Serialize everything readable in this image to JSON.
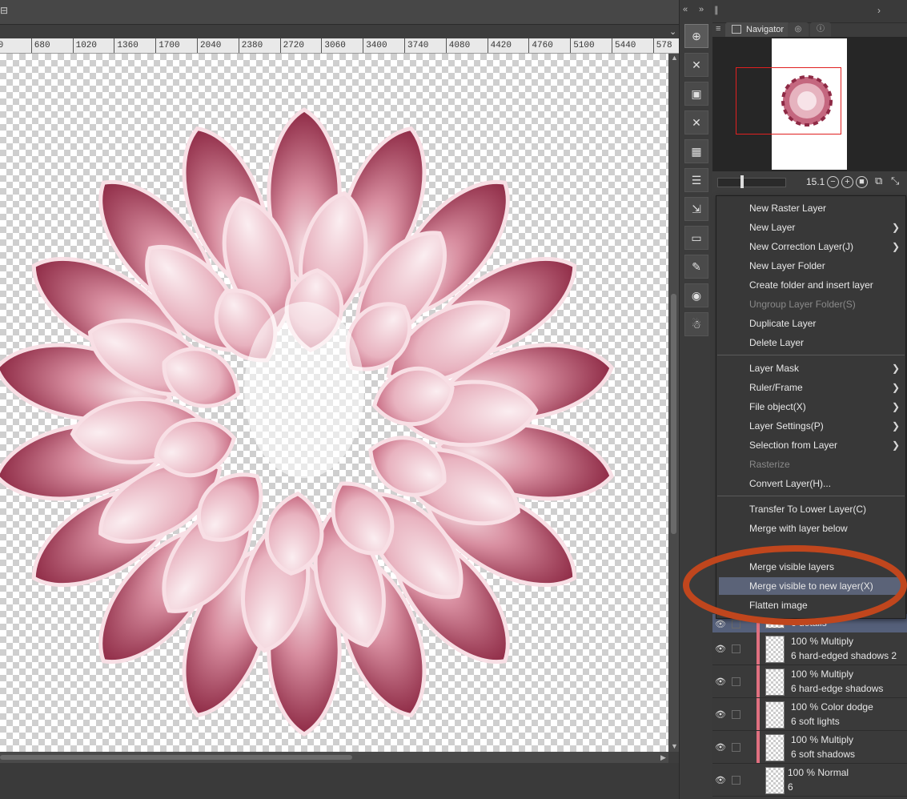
{
  "ruler": {
    "labels": [
      "40",
      "680",
      "1020",
      "1360",
      "1700",
      "2040",
      "2380",
      "2720",
      "3060",
      "3400",
      "3740",
      "4080",
      "4420",
      "4760",
      "5100",
      "5440",
      "578"
    ]
  },
  "toolbar_icons": [
    "zoom-icon",
    "close-cross-icon",
    "layer-folder-icon",
    "close-cross-icon",
    "texture-icon",
    "layer-list-icon",
    "move-layer-icon",
    "folder-icon",
    "edit-icon",
    "camera-icon",
    "pose-figure-icon"
  ],
  "navigator": {
    "tab_label": "Navigator",
    "zoom_value": "15.1",
    "zoom_hidden_value": "0.0"
  },
  "context_menu": {
    "items": [
      {
        "label": "New Raster Layer",
        "submenu": false,
        "disabled": false
      },
      {
        "label": "New Layer",
        "submenu": true,
        "disabled": false
      },
      {
        "label": "New Correction Layer(J)",
        "submenu": true,
        "disabled": false
      },
      {
        "label": "New Layer Folder",
        "submenu": false,
        "disabled": false
      },
      {
        "label": "Create folder and insert layer",
        "submenu": false,
        "disabled": false
      },
      {
        "label": "Ungroup Layer Folder(S)",
        "submenu": false,
        "disabled": true
      },
      {
        "label": "Duplicate Layer",
        "submenu": false,
        "disabled": false
      },
      {
        "label": "Delete Layer",
        "submenu": false,
        "disabled": false
      },
      {
        "label": "Layer Mask",
        "submenu": true,
        "disabled": false
      },
      {
        "label": "Ruler/Frame",
        "submenu": true,
        "disabled": false
      },
      {
        "label": "File object(X)",
        "submenu": true,
        "disabled": false
      },
      {
        "label": "Layer Settings(P)",
        "submenu": true,
        "disabled": false
      },
      {
        "label": "Selection from Layer",
        "submenu": true,
        "disabled": false
      },
      {
        "label": "Rasterize",
        "submenu": false,
        "disabled": true
      },
      {
        "label": "Convert Layer(H)...",
        "submenu": false,
        "disabled": false
      },
      {
        "label": "Transfer To Lower Layer(C)",
        "submenu": false,
        "disabled": false
      },
      {
        "label": "Merge with layer below",
        "submenu": false,
        "disabled": false
      },
      {
        "label": "Merge visible layers",
        "submenu": false,
        "disabled": false
      },
      {
        "label": "Merge visible to new layer(X)",
        "submenu": false,
        "disabled": false,
        "highlighted": true
      },
      {
        "label": "Flatten image",
        "submenu": false,
        "disabled": false
      }
    ]
  },
  "layers": [
    {
      "line1": "",
      "line2": "6 details",
      "selected": true
    },
    {
      "line1": "100 % Multiply",
      "line2": "6 hard-edged shadows 2"
    },
    {
      "line1": "100 % Multiply",
      "line2": "6 hard-edge shadows"
    },
    {
      "line1": "100 % Color dodge",
      "line2": "6 soft lights"
    },
    {
      "line1": "100 % Multiply",
      "line2": "6 soft shadows"
    },
    {
      "line1": "100 % Normal",
      "line2": "6"
    }
  ],
  "colors": {
    "canvas_petal_dark": "#8e2a45",
    "canvas_petal_mid": "#c96e86",
    "canvas_petal_light": "#f3d3da",
    "annotation_ellipse": "#c0461d",
    "navigator_rect": "#e02020",
    "menu_highlight": "#5b6378"
  }
}
